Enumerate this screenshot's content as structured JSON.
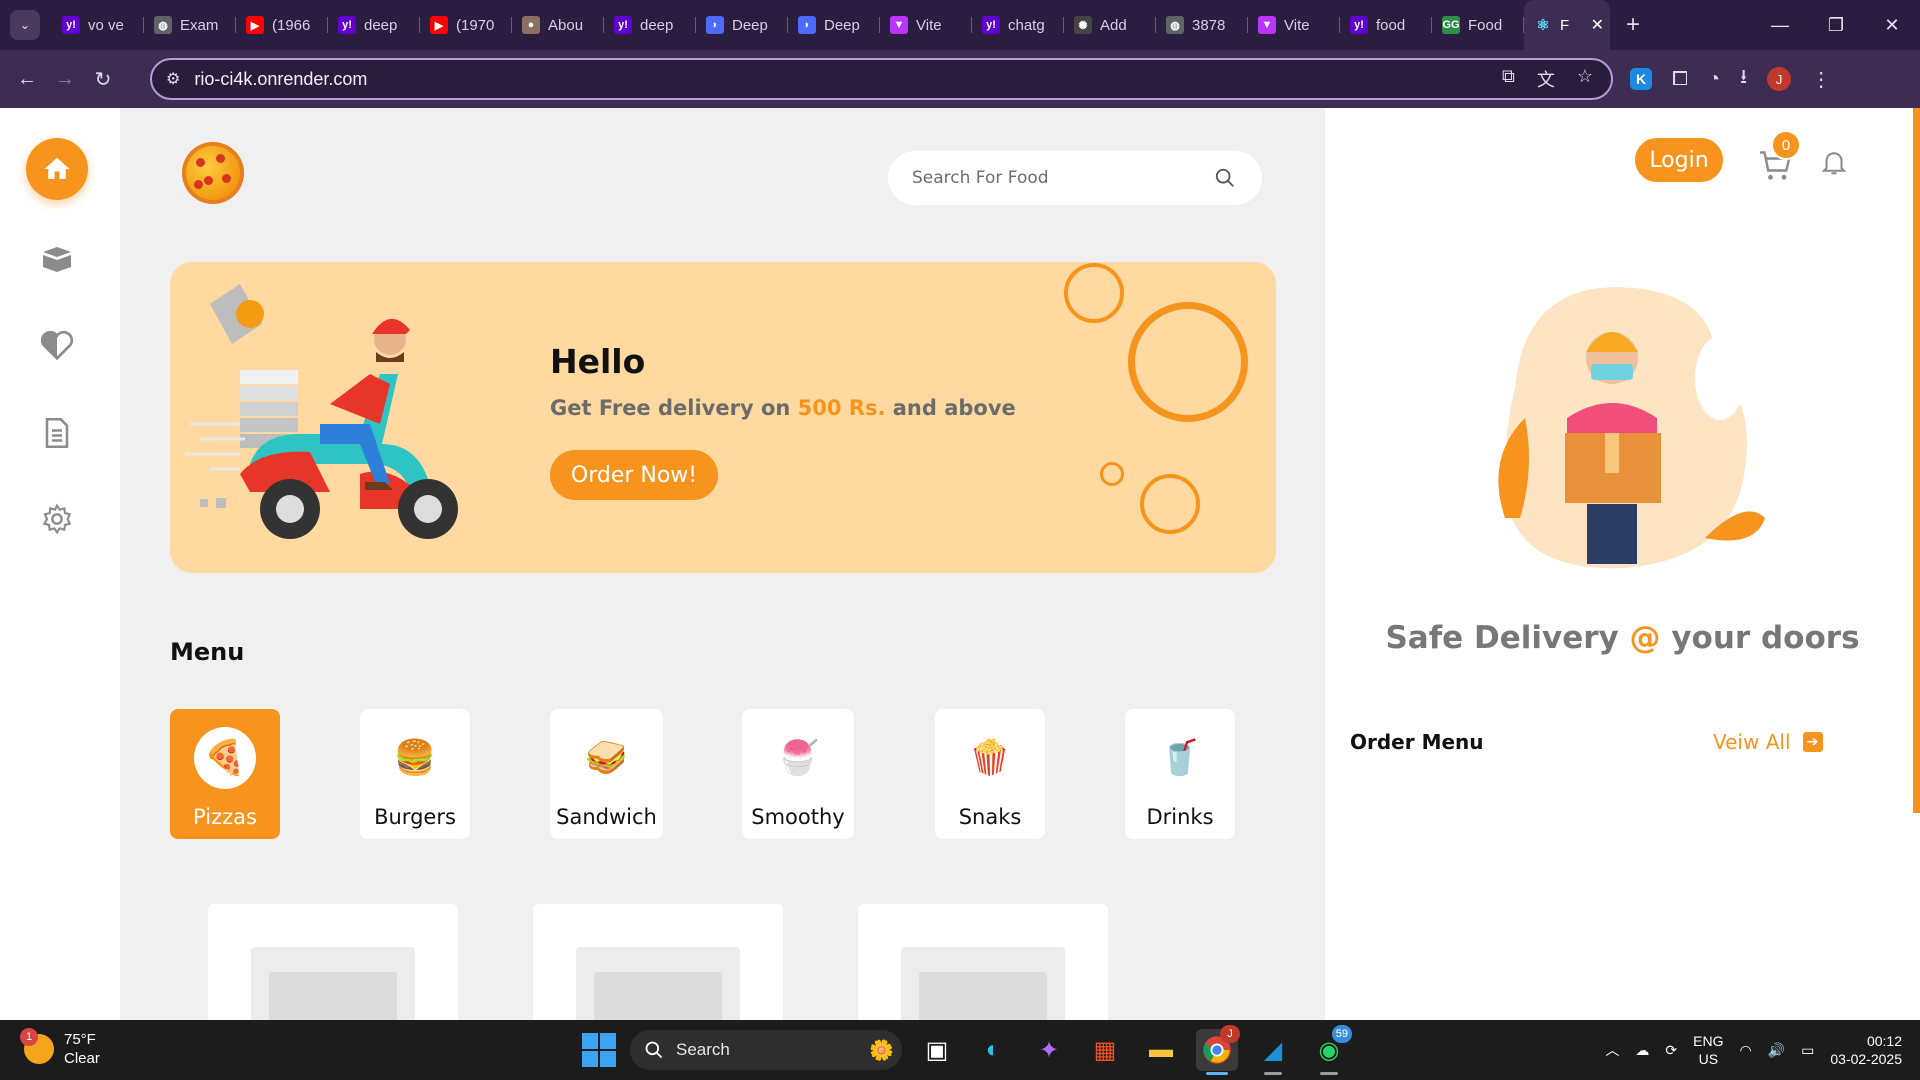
{
  "browser": {
    "tabs": [
      {
        "title": "vo ve",
        "icon": "yahoo-icon",
        "color": "#6001d2"
      },
      {
        "title": "Exam",
        "icon": "globe-icon",
        "color": "#5f6368"
      },
      {
        "title": "(1966",
        "icon": "youtube-icon",
        "color": "#ff0000"
      },
      {
        "title": "deep",
        "icon": "yahoo-icon",
        "color": "#6001d2"
      },
      {
        "title": "(1970",
        "icon": "youtube-icon",
        "color": "#ff0000"
      },
      {
        "title": "Abou",
        "icon": "avatar-icon",
        "color": "#8d6e63"
      },
      {
        "title": "deep",
        "icon": "yahoo-icon",
        "color": "#6001d2"
      },
      {
        "title": "Deep",
        "icon": "deepseek-icon",
        "color": "#4d6bfe"
      },
      {
        "title": "Deep",
        "icon": "deepseek-icon",
        "color": "#4d6bfe"
      },
      {
        "title": "Vite",
        "icon": "vite-icon",
        "color": "#bd34fe"
      },
      {
        "title": "chatg",
        "icon": "yahoo-icon",
        "color": "#6001d2"
      },
      {
        "title": "Add",
        "icon": "openai-icon",
        "color": "#444444"
      },
      {
        "title": "3878",
        "icon": "globe-icon",
        "color": "#5f6368"
      },
      {
        "title": "Vite",
        "icon": "vite-icon",
        "color": "#bd34fe"
      },
      {
        "title": "food",
        "icon": "yahoo-icon",
        "color": "#6001d2"
      },
      {
        "title": "Food",
        "icon": "geeksforgeeks-icon",
        "color": "#2f8d46"
      }
    ],
    "active_tab": {
      "title": "F",
      "icon": "react-icon"
    },
    "new_tab_symbol": "+",
    "url": "rio-ci4k.onrender.com",
    "profile_initial": "J",
    "extension_letter": "K"
  },
  "sidebar": {
    "items": [
      {
        "name": "home",
        "icon": "home-icon"
      },
      {
        "name": "orders",
        "icon": "box-icon"
      },
      {
        "name": "favorites",
        "icon": "heart-icon"
      },
      {
        "name": "documents",
        "icon": "document-icon"
      },
      {
        "name": "settings",
        "icon": "gear-icon"
      }
    ]
  },
  "header": {
    "search_placeholder": "Search For Food"
  },
  "banner": {
    "greeting": "Hello",
    "subtitle_prefix": "Get Free delivery on ",
    "subtitle_highlight": "500 Rs.",
    "subtitle_suffix": " and above",
    "cta": "Order Now!"
  },
  "menu": {
    "title": "Menu",
    "categories": [
      {
        "label": "Pizzas",
        "icon": "pizza-icon",
        "glyph": "🍕",
        "active": true
      },
      {
        "label": "Burgers",
        "icon": "burger-icon",
        "glyph": "🍔",
        "active": false
      },
      {
        "label": "Sandwich",
        "icon": "sandwich-icon",
        "glyph": "🥪",
        "active": false
      },
      {
        "label": "Smoothy",
        "icon": "smoothie-icon",
        "glyph": "🍧",
        "active": false
      },
      {
        "label": "Snaks",
        "icon": "popcorn-icon",
        "glyph": "🍿",
        "active": false
      },
      {
        "label": "Drinks",
        "icon": "drink-icon",
        "glyph": "🥤",
        "active": false
      }
    ]
  },
  "right_panel": {
    "login": "Login",
    "cart_count": "0",
    "tagline_left": "Safe Delivery ",
    "tagline_at": "@",
    "tagline_right": " your doors",
    "order_menu_title": "Order Menu",
    "view_all": "Veiw All"
  },
  "colors": {
    "accent": "#f7941d",
    "banner_bg": "#ffd9a0"
  },
  "taskbar": {
    "weather_temp": "75°F",
    "weather_desc": "Clear",
    "weather_badge": "1",
    "search_label": "Search",
    "whatsapp_badge": "59",
    "chrome_badge": "J",
    "lang_top": "ENG",
    "lang_bottom": "US",
    "time": "00:12",
    "date": "03-02-2025"
  }
}
